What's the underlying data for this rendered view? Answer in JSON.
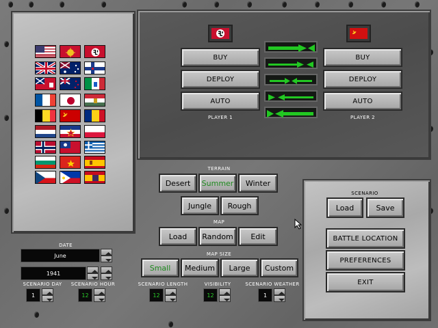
{
  "player1": {
    "label": "PLAYER 1",
    "buy": "BUY",
    "deploy": "DEPLOY",
    "auto": "AUTO"
  },
  "player2": {
    "label": "PLAYER 2",
    "buy": "BUY",
    "deploy": "DEPLOY",
    "auto": "AUTO"
  },
  "terrain": {
    "label": "TERRAIN",
    "options": [
      "Desert",
      "Summer",
      "Winter",
      "Jungle",
      "Rough"
    ],
    "selected": "Summer"
  },
  "map": {
    "label": "MAP",
    "load": "Load",
    "random": "Random",
    "edit": "Edit"
  },
  "map_size": {
    "label": "MAP SIZE",
    "options": [
      "Small",
      "Medium",
      "Large",
      "Custom"
    ],
    "selected": "Small"
  },
  "date": {
    "label": "DATE",
    "month": "June",
    "year": "1941"
  },
  "scenario_day": {
    "label": "SCENARIO DAY",
    "value": "1"
  },
  "scenario_hour": {
    "label": "SCENARIO HOUR",
    "value": "12"
  },
  "scenario_length": {
    "label": "SCENARIO LENGTH",
    "value": "12"
  },
  "visibility": {
    "label": "VISIBILITY",
    "value": "12"
  },
  "scenario_weather": {
    "label": "SCENARIO WEATHER",
    "value": "1"
  },
  "scenario": {
    "label": "SCENARIO",
    "load": "Load",
    "save": "Save"
  },
  "menu": {
    "battle_location": "BATTLE LOCATION",
    "preferences": "PREFERENCES",
    "exit": "EXIT"
  },
  "colors": {
    "selected_text": "#1f8a1f",
    "arrow_green": "#22c822",
    "panel_dark": "#4f4f4f",
    "panel_light": "#b5b5b5"
  },
  "nations": [
    "usa-flag",
    "rising-sun-army-flag",
    "nazi-flag",
    "uk-flag",
    "australia-flag",
    "finland-cross-flag",
    "canada-red-ensign-flag",
    "new-zealand-flag",
    "italy-flag",
    "france-flag",
    "japan-flag",
    "hungary-flag",
    "belgium-flag",
    "soviet-flag",
    "romania-flag",
    "netherlands-flag",
    "yugoslavia-flag",
    "poland-flag",
    "norway-flag",
    "china-flag",
    "greece-flag",
    "bulgaria-flag",
    "north-vietnam-flag",
    "spain-flag",
    "czech-flag",
    "philippines-flag",
    "spain-1945-flag"
  ]
}
